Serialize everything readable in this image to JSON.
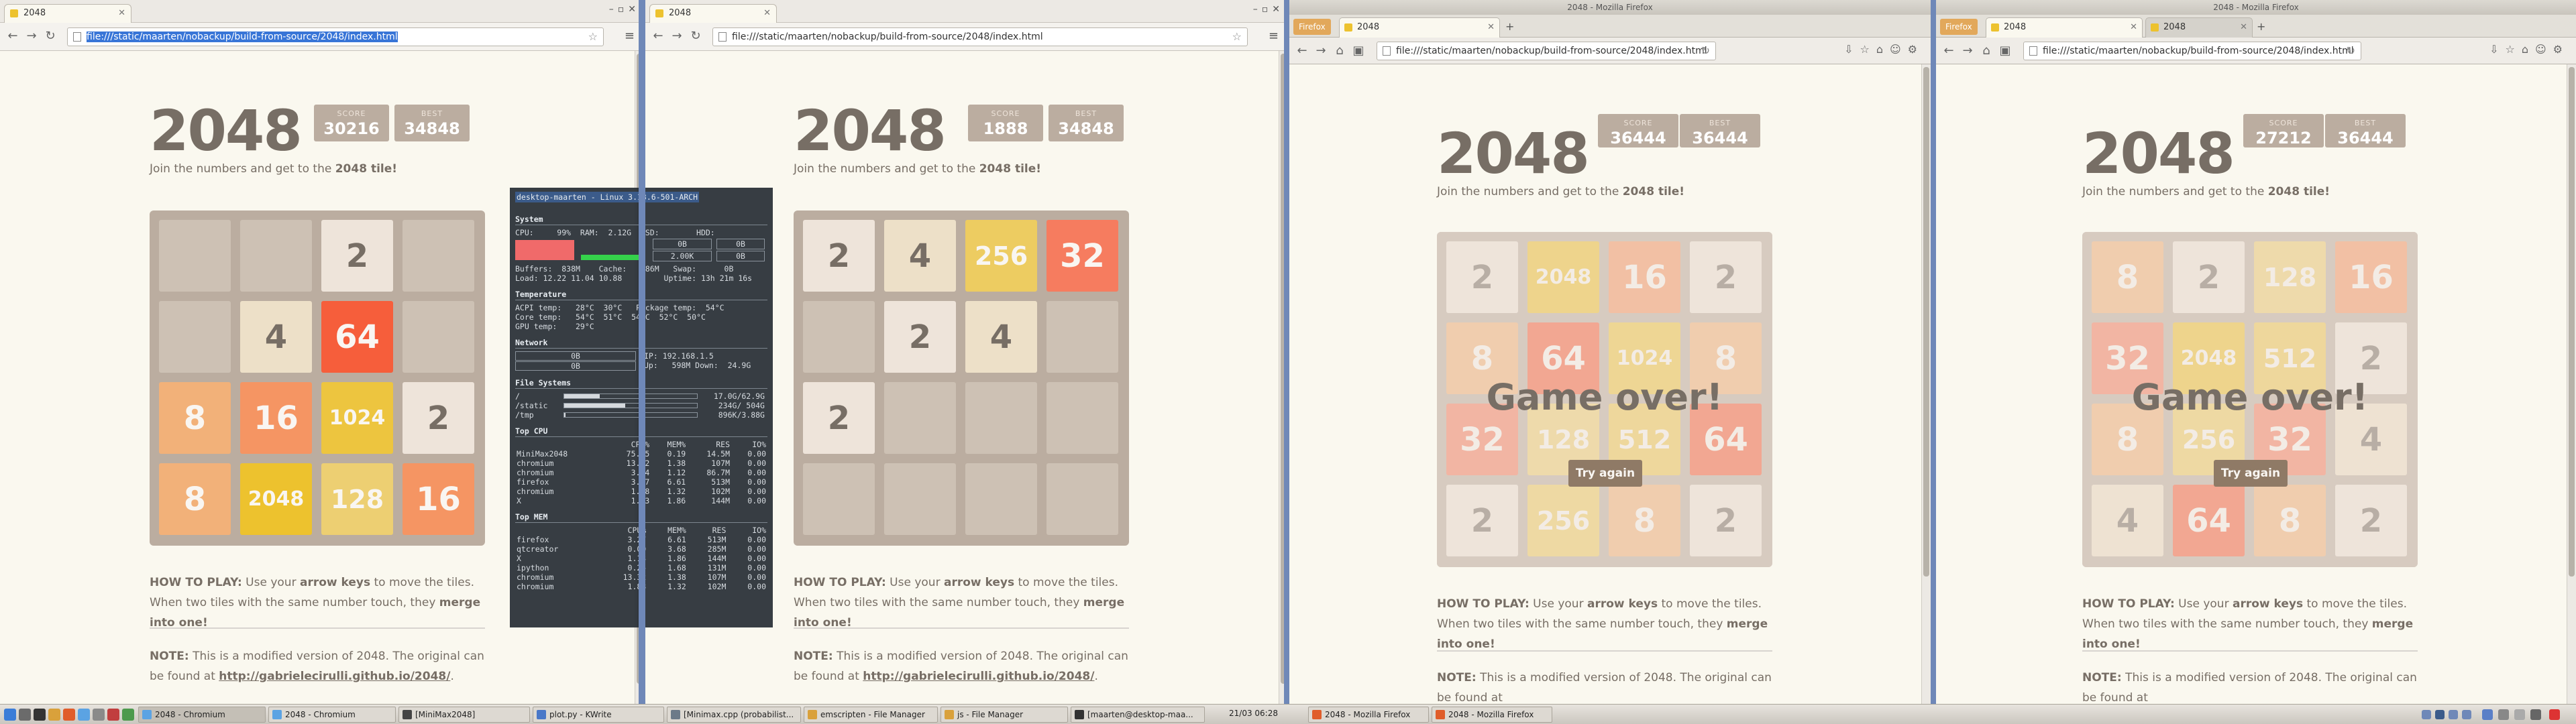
{
  "page": {
    "game_title": "2048",
    "score_label": "SCORE",
    "best_label": "BEST",
    "intro_prefix": "Join the numbers and get to the ",
    "intro_bold": "2048 tile!",
    "howto_label": "HOW TO PLAY:",
    "howto_1": " Use your ",
    "howto_keys": "arrow keys",
    "howto_2": " to move the tiles. When two tiles with the same number touch, they ",
    "howto_merge": "merge into one!",
    "note_label": "NOTE:",
    "note_text": " This is a modified version of 2048. The original can be found at ",
    "note_link": "http://gabrielecirulli.github.io/2048/",
    "game_over": "Game over!",
    "try_again": "Try again"
  },
  "windows": [
    {
      "browser": "chromium",
      "tab": "2048",
      "url": "file:///static/maarten/nobackup/build-from-source/2048/index.html",
      "url_selected": true,
      "score": "30216",
      "best": "34848",
      "grid": [
        [
          0,
          0,
          2,
          0
        ],
        [
          0,
          4,
          64,
          0
        ],
        [
          8,
          16,
          1024,
          2
        ],
        [
          8,
          2048,
          128,
          16
        ]
      ],
      "game_over": false
    },
    {
      "browser": "chromium",
      "tab": "2048",
      "url": "file:///static/maarten/nobackup/build-from-source/2048/index.html",
      "url_selected": false,
      "score": "1888",
      "best": "34848",
      "grid": [
        [
          2,
          4,
          256,
          32
        ],
        [
          0,
          2,
          4,
          0
        ],
        [
          2,
          0,
          0,
          0
        ],
        [
          0,
          0,
          0,
          0
        ]
      ],
      "game_over": false
    },
    {
      "browser": "firefox",
      "title": "2048 - Mozilla Firefox",
      "tab": "2048",
      "url": "file:///static/maarten/nobackup/build-from-source/2048/index.html",
      "score": "36444",
      "best": "36444",
      "grid": [
        [
          2,
          2048,
          16,
          2
        ],
        [
          8,
          64,
          1024,
          8
        ],
        [
          32,
          128,
          512,
          64
        ],
        [
          2,
          256,
          8,
          2
        ]
      ],
      "game_over": true
    },
    {
      "browser": "firefox",
      "title": "2048 - Mozilla Firefox",
      "tab": "2048",
      "tab2": "2048",
      "url": "file:///static/maarten/nobackup/build-from-source/2048/index.html",
      "score": "27212",
      "best": "36444",
      "grid": [
        [
          8,
          2,
          128,
          16
        ],
        [
          32,
          2048,
          512,
          2
        ],
        [
          8,
          256,
          32,
          4
        ],
        [
          4,
          64,
          8,
          2
        ]
      ],
      "game_over": true
    }
  ],
  "firefox_menu": "Firefox",
  "conky": {
    "host": "desktop-maarten - Linux 3.13.6-501-ARCH",
    "system": "System",
    "cpu_line": "CPU:     99%  RAM:  2.12G  SSD:        HDD:",
    "ssd_vals": [
      "0B",
      "2.00K"
    ],
    "hdd_vals": [
      "0B",
      "0B"
    ],
    "buffers": "Buffers:  838M    Cache:   786M   Swap:      0B",
    "load": "Load: 12.22 11.04 10.88         Uptime: 13h 21m 16s",
    "temperature": "Temperature",
    "temp1": "ACPI temp:   28°C  30°C   Package temp:  54°C",
    "temp2": "Core temp:   54°C  51°C  54°C  52°C  50°C",
    "temp3": "GPU temp:    29°C",
    "network": "Network",
    "net_ip": "IP: 192.168.1.5",
    "net_up": "Up:   598M Down:  24.9G",
    "net_vals": [
      "0B",
      "0B"
    ],
    "filesystems": "File Systems",
    "fs": [
      [
        "/",
        "17.0G/62.9G"
      ],
      [
        "/static",
        "234G/ 504G"
      ],
      [
        "/tmp",
        "896K/3.88G"
      ]
    ],
    "top_cpu": "Top CPU",
    "top_cpu_head": [
      "",
      "CPU%",
      "MEM%",
      "RES",
      "IO%"
    ],
    "top_cpu_rows": [
      [
        "MiniMax2048",
        "75.75",
        "0.19",
        "14.5M",
        "0.00"
      ],
      [
        "chromium",
        "13.52",
        "1.38",
        "107M",
        "0.00"
      ],
      [
        "chromium",
        "3.64",
        "1.12",
        "86.7M",
        "0.00"
      ],
      [
        "firefox",
        "3.27",
        "6.61",
        "513M",
        "0.00"
      ],
      [
        "chromium",
        "1.88",
        "1.32",
        "102M",
        "0.00"
      ],
      [
        "X",
        "1.13",
        "1.86",
        "144M",
        "0.00"
      ]
    ],
    "top_mem": "Top MEM",
    "top_mem_rows": [
      [
        "firefox",
        "3.27",
        "6.61",
        "513M",
        "0.00"
      ],
      [
        "qtcreator",
        "0.00",
        "3.68",
        "285M",
        "0.00"
      ],
      [
        "X",
        "1.13",
        "1.86",
        "144M",
        "0.00"
      ],
      [
        "ipython",
        "0.25",
        "1.68",
        "131M",
        "0.00"
      ],
      [
        "chromium",
        "13.32",
        "1.38",
        "107M",
        "0.00"
      ],
      [
        "chromium",
        "1.88",
        "1.32",
        "102M",
        "0.00"
      ]
    ]
  },
  "taskbar": {
    "tasks_left": [
      "2048 - Chromium",
      "2048 - Chromium",
      "[MiniMax2048]",
      "plot.py - KWrite",
      "[Minimax.cpp (probabilist...",
      "emscripten - File Manager",
      "js - File Manager",
      "[maarten@desktop-maa..."
    ],
    "clock": "21/03  06:28",
    "tasks_right": [
      "2048 - Mozilla Firefox",
      "2048 - Mozilla Firefox"
    ]
  },
  "colors": {
    "board": "#bbada0",
    "empty": "#cdc1b4",
    "text_dark": "#776e65",
    "text_light": "#f9f6f2",
    "background": "#faf8ef",
    "button": "#8f7a66"
  },
  "icons": [
    "back-icon",
    "forward-icon",
    "reload-icon",
    "star-icon",
    "menu-icon",
    "page-icon",
    "close-icon"
  ]
}
